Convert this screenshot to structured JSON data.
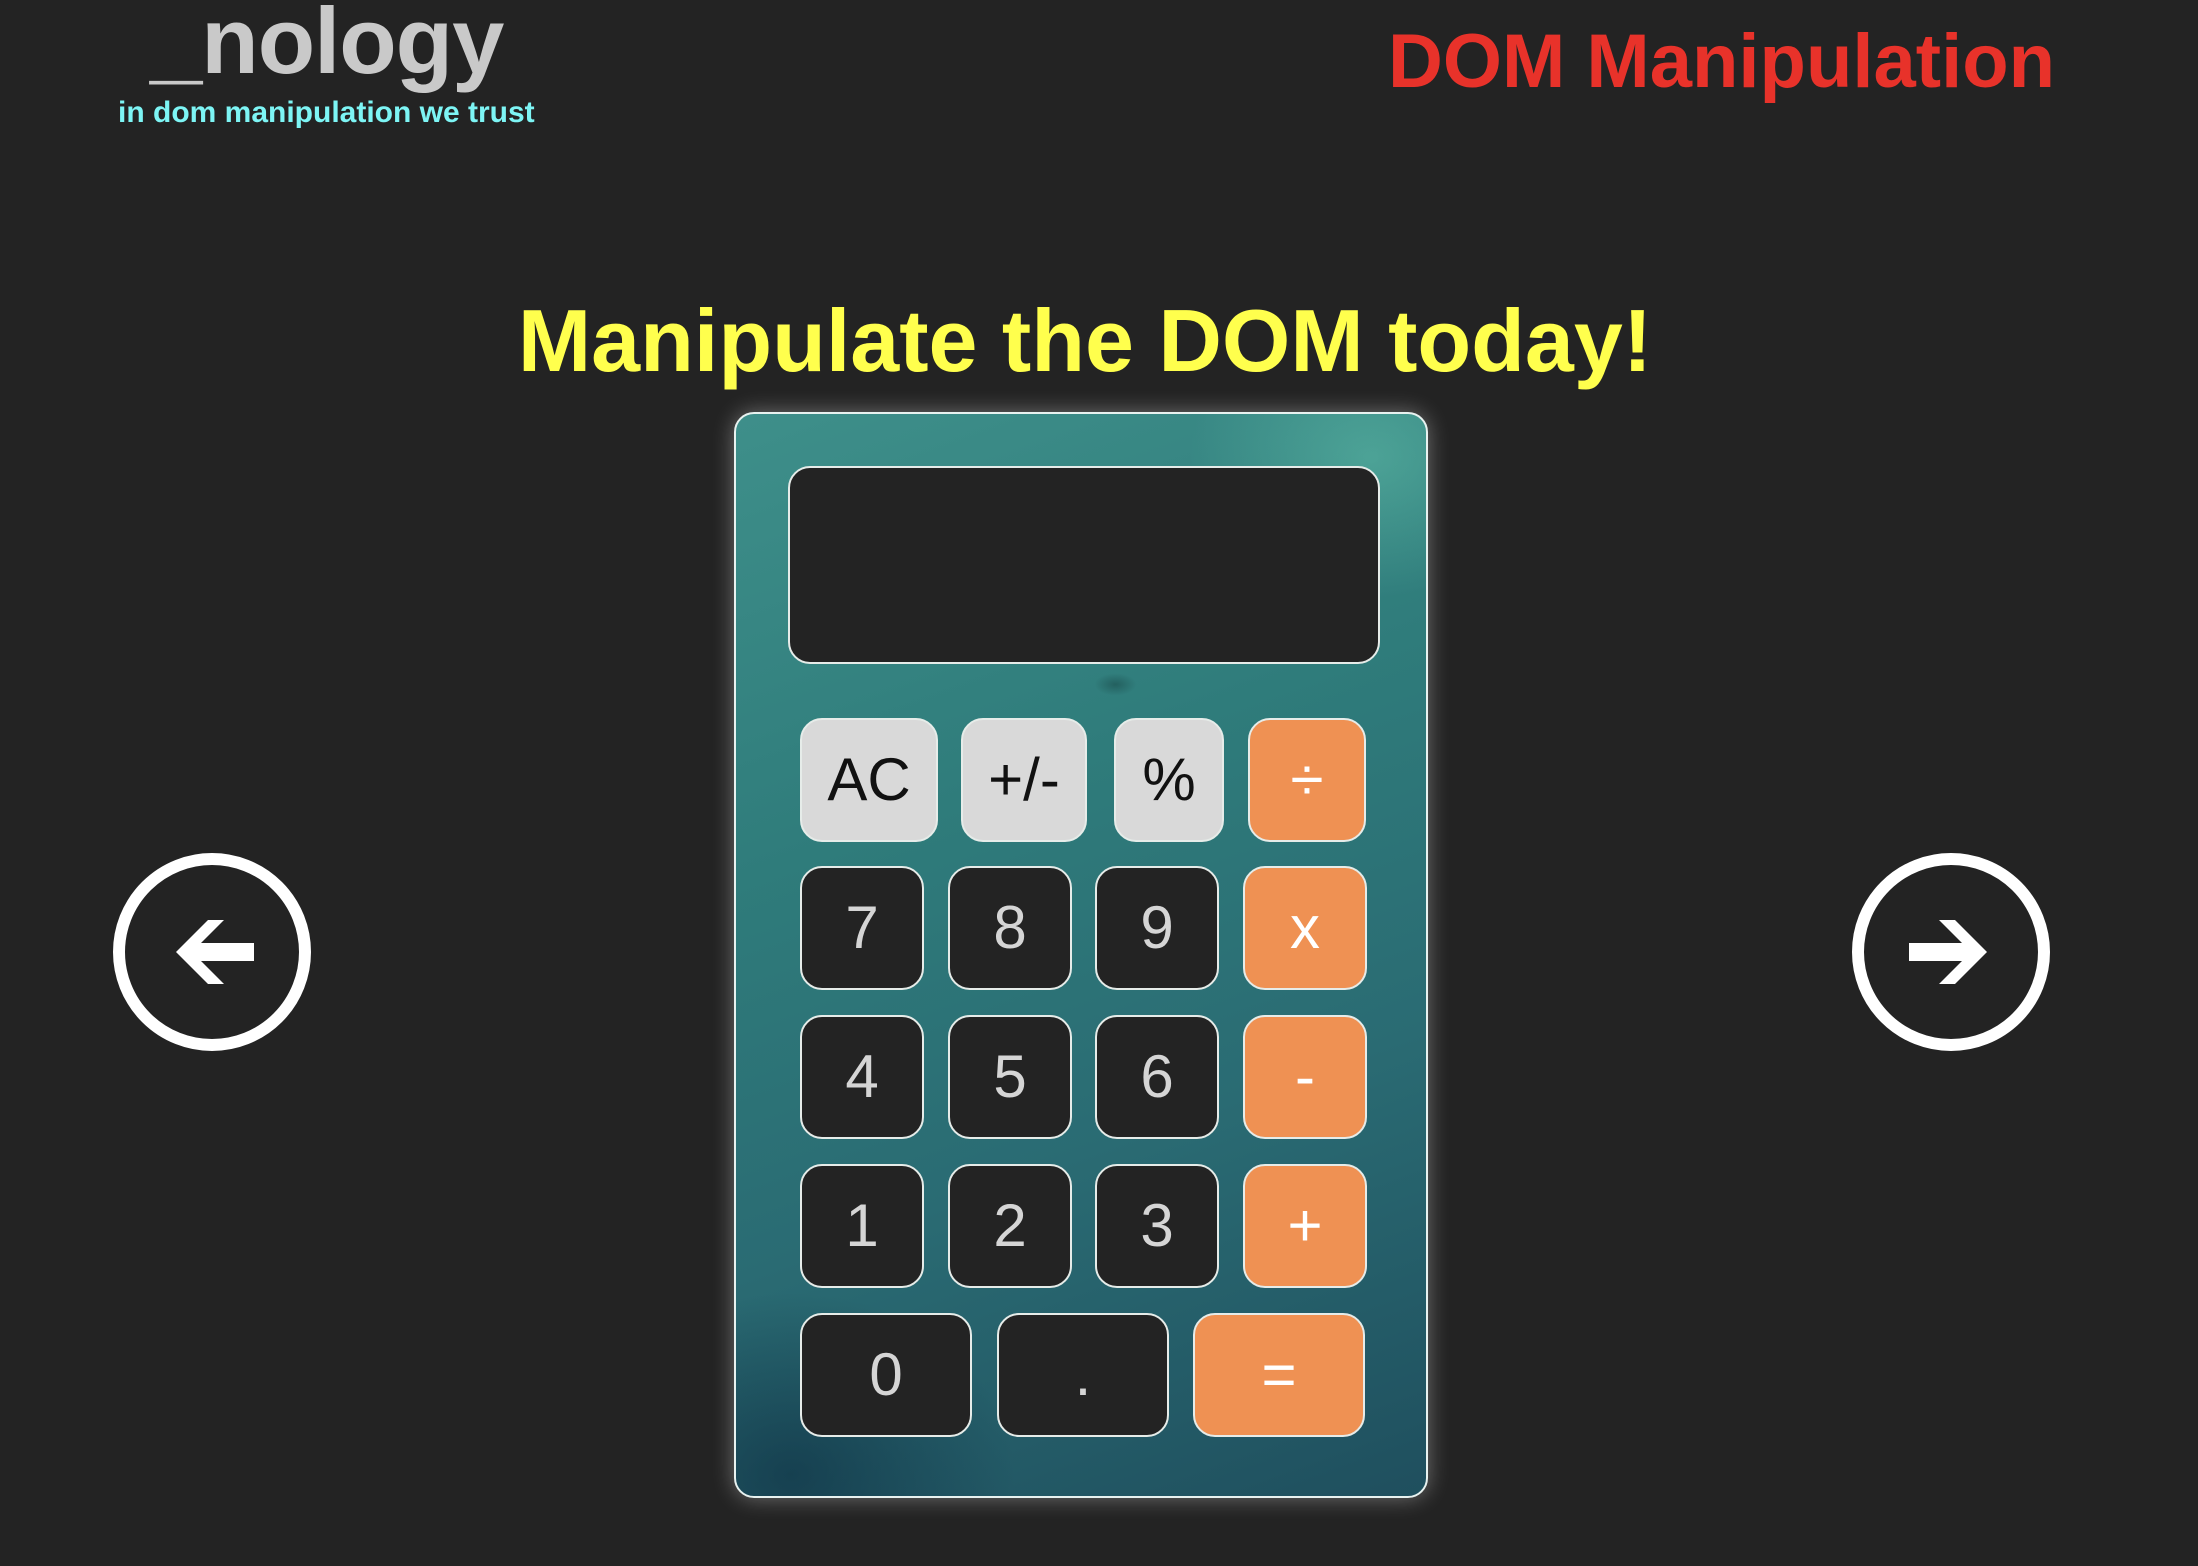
{
  "header": {
    "brand_name": "_nology",
    "brand_tagline": "in dom manipulation we trust",
    "page_heading": "DOM Manipulation"
  },
  "hero": {
    "title": "Manipulate the DOM today!"
  },
  "navigation": {
    "prev_icon": "arrow-circle-left-icon",
    "next_icon": "arrow-circle-right-icon"
  },
  "calculator": {
    "display_value": "",
    "keys": [
      {
        "label": "AC",
        "type": "function"
      },
      {
        "label": "+/-",
        "type": "function"
      },
      {
        "label": "%",
        "type": "function"
      },
      {
        "label": "÷",
        "type": "operator"
      },
      {
        "label": "7",
        "type": "number"
      },
      {
        "label": "8",
        "type": "number"
      },
      {
        "label": "9",
        "type": "number"
      },
      {
        "label": "x",
        "type": "operator"
      },
      {
        "label": "4",
        "type": "number"
      },
      {
        "label": "5",
        "type": "number"
      },
      {
        "label": "6",
        "type": "number"
      },
      {
        "label": "-",
        "type": "operator"
      },
      {
        "label": "1",
        "type": "number"
      },
      {
        "label": "2",
        "type": "number"
      },
      {
        "label": "3",
        "type": "number"
      },
      {
        "label": "+",
        "type": "operator"
      },
      {
        "label": "0",
        "type": "number"
      },
      {
        "label": ".",
        "type": "number"
      },
      {
        "label": "=",
        "type": "operator"
      }
    ]
  },
  "colors": {
    "background": "#232323",
    "brand_name": "#c9c9c9",
    "brand_tagline": "#7df5f5",
    "page_heading": "#e8322a",
    "hero_title": "#ffff4d",
    "operator_key": "#ef9153",
    "function_key": "#d9d9d9",
    "number_key": "#232323",
    "calculator_body": "#2f7c7b"
  }
}
